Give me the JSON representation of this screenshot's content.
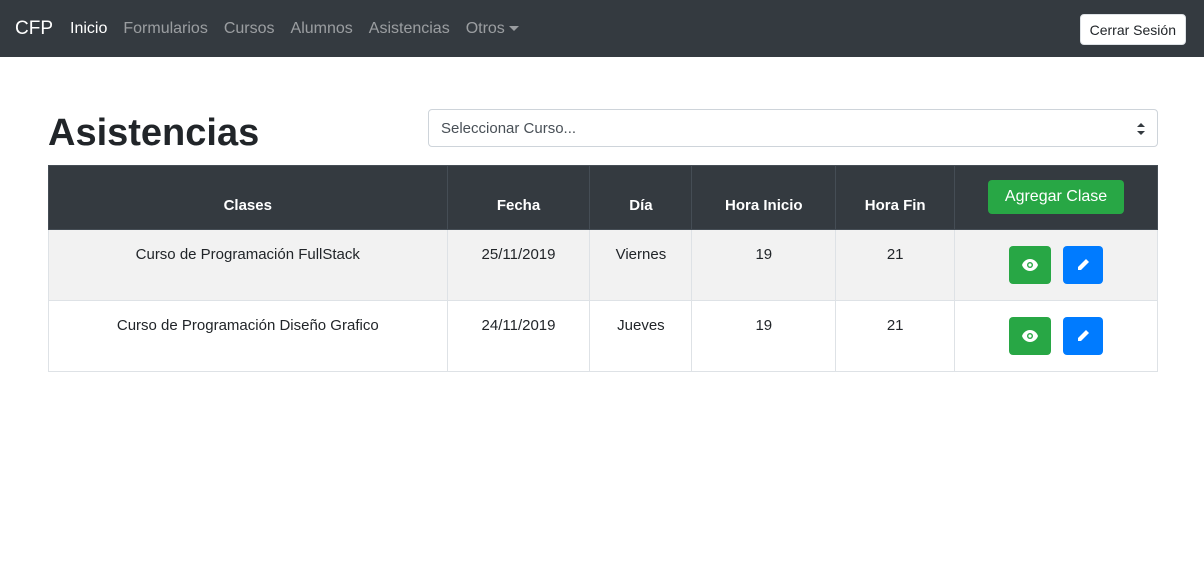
{
  "navbar": {
    "brand": "CFP",
    "links": [
      {
        "label": "Inicio",
        "active": true
      },
      {
        "label": "Formularios",
        "active": false
      },
      {
        "label": "Cursos",
        "active": false
      },
      {
        "label": "Alumnos",
        "active": false
      },
      {
        "label": "Asistencias",
        "active": false
      },
      {
        "label": "Otros",
        "active": false,
        "dropdown": true
      }
    ],
    "logout_label": "Cerrar Sesión"
  },
  "page": {
    "title": "Asistencias",
    "course_select": {
      "selected": "Seleccionar Curso..."
    }
  },
  "table": {
    "headers": [
      "Clases",
      "Fecha",
      "Día",
      "Hora Inicio",
      "Hora Fin"
    ],
    "add_button_label": "Agregar Clase",
    "rows": [
      {
        "clase": "Curso de Programación FullStack",
        "fecha": "25/11/2019",
        "dia": "Viernes",
        "hora_inicio": "19",
        "hora_fin": "21"
      },
      {
        "clase": "Curso de Programación Diseño Grafico",
        "fecha": "24/11/2019",
        "dia": "Jueves",
        "hora_inicio": "19",
        "hora_fin": "21"
      }
    ],
    "row_actions": {
      "view_icon": "eye-icon",
      "edit_icon": "pencil-icon"
    }
  },
  "colors": {
    "navbar_bg": "#343a40",
    "success": "#28a745",
    "primary": "#007bff",
    "striped_row": "#f2f2f2"
  }
}
